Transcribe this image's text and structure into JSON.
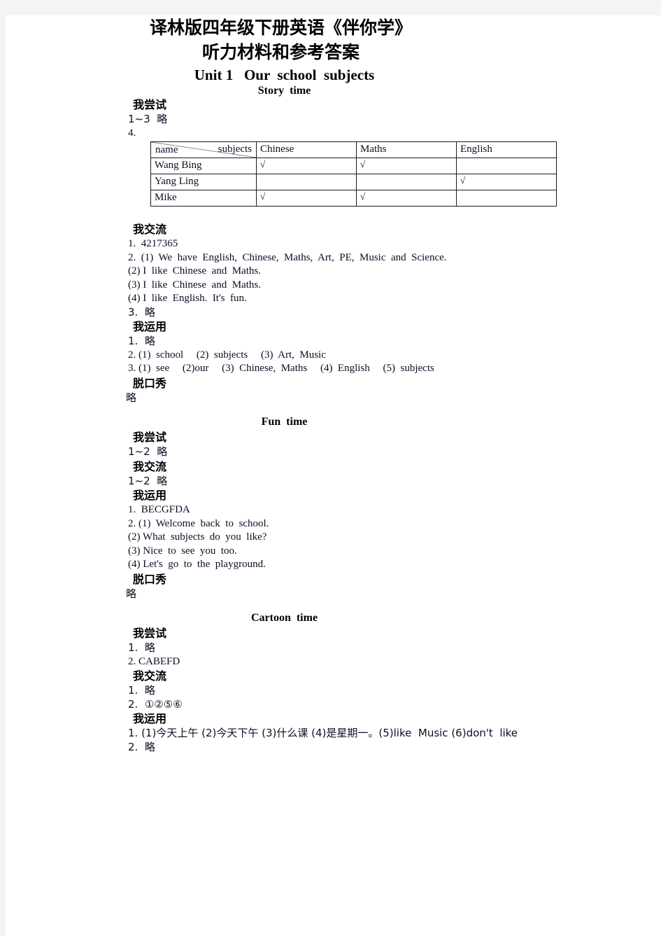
{
  "document": {
    "title_lines": [
      "译林版四年级下册英语《伴你学》",
      "听力材料和参考答案"
    ],
    "unit_title": "Unit 1   Our  school  subjects"
  },
  "parts": {
    "story_time": "Story  time",
    "fun_time": "Fun  time",
    "cartoon_time": "Cartoon  time"
  },
  "headings": {
    "try": "我尝试",
    "communicate": "我交流",
    "apply": "我运用",
    "talk_show": "脱口秀"
  },
  "story": {
    "try": {
      "line1": "1~3  略",
      "line2": "4."
    },
    "table": {
      "corner_subject_label": "subjects",
      "corner_name_label": "name",
      "columns": [
        "Chinese",
        "Maths",
        "English"
      ],
      "check_glyph": "√",
      "rows": [
        {
          "name": "Wang  Bing",
          "marks": [
            true,
            true,
            false
          ]
        },
        {
          "name": "Yang  Ling",
          "marks": [
            false,
            false,
            true
          ]
        },
        {
          "name": "Mike",
          "marks": [
            true,
            true,
            false
          ]
        }
      ]
    },
    "communicate": [
      "1.  4217365",
      "2.  (1)  We  have  English,  Chinese,  Maths,  Art,  PE,  Music  and  Science.",
      "(2) I  like  Chinese  and  Maths.",
      "(3) I  like  Chinese  and  Maths.",
      "(4) I  like  English.  It's  fun.",
      "3.  略"
    ],
    "apply": [
      "1.  略",
      "2. (1)  school     (2)  subjects     (3)  Art,  Music",
      "3. (1)  see     (2)our     (3)  Chinese,  Maths     (4)  English     (5)  subjects"
    ],
    "talk_show": "略"
  },
  "fun": {
    "try": "1~2  略",
    "communicate": "1~2  略",
    "apply": [
      "1.  BECGFDA",
      "2. (1)  Welcome  back  to  school.",
      "(2) What  subjects  do  you  like?",
      "(3) Nice  to  see  you  too.",
      "(4) Let's  go  to  the  playground."
    ],
    "talk_show": "略"
  },
  "cartoon": {
    "try": [
      "1.  略",
      "2. CABEFD"
    ],
    "communicate": [
      "1.  略",
      "2.  ①②⑤⑥"
    ],
    "apply": [
      "1. (1)今天上午 (2)今天下午 (3)什么课 (4)是星期一。(5)like  Music (6)don't  like",
      "2.  略"
    ]
  }
}
